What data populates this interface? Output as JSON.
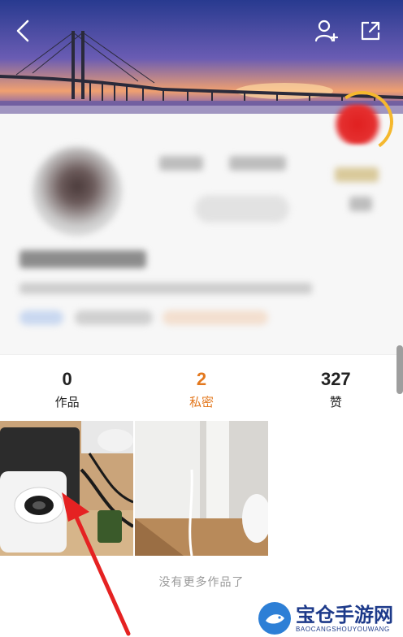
{
  "header": {
    "back_icon": "chevron-left-icon",
    "follow_icon": "add-user-icon",
    "share_icon": "share-icon"
  },
  "tabs": [
    {
      "count": "0",
      "label": "作品",
      "active": false
    },
    {
      "count": "2",
      "label": "私密",
      "active": true
    },
    {
      "count": "327",
      "label": "赞",
      "active": false
    }
  ],
  "colors": {
    "accent": "#e3781e",
    "text": "#222222",
    "footer": "#9a9a9a",
    "annotation_arrow": "#e52222"
  },
  "footer": {
    "no_more_text": "没有更多作品了"
  },
  "watermark": {
    "title": "宝仓手游网",
    "subtitle": "BAOCANGSHOUYOUWANG"
  }
}
